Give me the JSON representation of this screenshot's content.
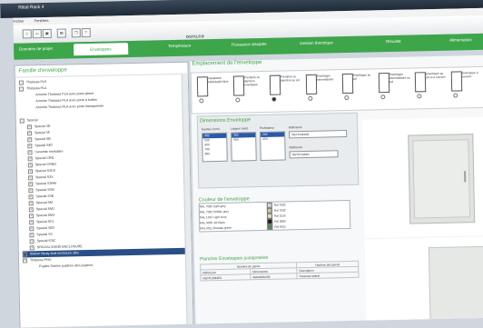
{
  "window": {
    "title": "Rittal Rack 4"
  },
  "menu": [
    "Fichier",
    "Fenêtres"
  ],
  "toolbar": {
    "brand": "OUTILCO",
    "buttons": [
      "new-icon",
      "open-icon",
      "save-icon",
      "print-icon",
      "copy-icon",
      "help-icon"
    ]
  },
  "tabs": [
    {
      "label": "Données de projet"
    },
    {
      "label": "Enveloppes",
      "active": true
    },
    {
      "label": "Température"
    },
    {
      "label": "Puissance dissipée"
    },
    {
      "label": "Gestion thermique"
    },
    {
      "label": "Résultat"
    },
    {
      "label": "Alimentation"
    }
  ],
  "left": {
    "title": "Famille d'enveloppe",
    "items": [
      {
        "label": "Thalassa PLS",
        "level": 0,
        "exp": "-"
      },
      {
        "label": "Thalassa PLA",
        "level": 0,
        "exp": "-"
      },
      {
        "label": "Armoire Thalassa PLA avec porte pleine",
        "level": 2
      },
      {
        "label": "Armoire Thalassa PLA avec porte à hublot",
        "level": 2
      },
      {
        "label": "Armoire Thalassa PLA avec porte transparente",
        "level": 2
      },
      {
        "label": "",
        "level": 0
      },
      {
        "label": "Spacial",
        "level": 0,
        "exp": "-"
      },
      {
        "label": "Spacial 3D",
        "level": 1,
        "exp": "+"
      },
      {
        "label": "Spacial 3F",
        "level": 1,
        "exp": "+"
      },
      {
        "label": "Spacial SB",
        "level": 1,
        "exp": "+"
      },
      {
        "label": "Spacial SBT",
        "level": 1,
        "exp": "+"
      },
      {
        "label": "Cassette modulaire",
        "level": 1,
        "exp": "+"
      },
      {
        "label": "Spacial CRN",
        "level": 1,
        "exp": "+"
      },
      {
        "label": "Spacial CRNG",
        "level": 1,
        "exp": "+"
      },
      {
        "label": "Spacial S3DX",
        "level": 1,
        "exp": "+"
      },
      {
        "label": "Spacial S3X",
        "level": 1,
        "exp": "+"
      },
      {
        "label": "Spacial S3HM",
        "level": 1,
        "exp": "+"
      },
      {
        "label": "Spacial S3M",
        "level": 1,
        "exp": "+"
      },
      {
        "label": "Spacial S3E",
        "level": 1,
        "exp": "+"
      },
      {
        "label": "Spacial SM",
        "level": 1,
        "exp": "+"
      },
      {
        "label": "Spacial SM1",
        "level": 1,
        "exp": "+"
      },
      {
        "label": "Spacial SM3",
        "level": 1,
        "exp": "+"
      },
      {
        "label": "Spacial SF1",
        "level": 1,
        "exp": "+"
      },
      {
        "label": "Spacial SE3",
        "level": 1,
        "exp": "+"
      },
      {
        "label": "Spacial S3",
        "level": 1,
        "exp": "+"
      },
      {
        "label": "Spacial S3IC",
        "level": 1,
        "exp": "+"
      },
      {
        "label": "SPACIAL EXEDI ENCLOSURE",
        "level": 1,
        "exp": "+"
      },
      {
        "label": "Station Neuty dual enclosure ultra",
        "level": 0,
        "exp": "-",
        "selected": true
      },
      {
        "label": "Thalassa PHO",
        "level": 0,
        "exp": "+"
      },
      {
        "label": "Pupitre Station pupitres ultra pupitres",
        "level": 2
      }
    ]
  },
  "right": {
    "pos_title": "Emplacement de l'enveloppe",
    "positions": [
      {
        "label": "Installation individuelle libre",
        "selected": false
      },
      {
        "label": "Première ou dernière enveloppe",
        "selected": false
      },
      {
        "label": "Première ou dernière au sol",
        "selected": true
      },
      {
        "label": "Enveloppe intermédiaire",
        "selected": false
      },
      {
        "label": "Enveloppe au sol",
        "selected": false
      },
      {
        "label": "Enveloppe intermédiaire au sol",
        "selected": false
      },
      {
        "label": "Enveloppe au sol et à couvert",
        "selected": false
      },
      {
        "label": "Enveloppe à couvert",
        "selected": false
      }
    ],
    "dims_title": "Dimensions Enveloppe",
    "dims": {
      "h_label": "Hauteur (mm)",
      "w_label": "Largeur (mm)",
      "ref_label": "Référence",
      "prof_label": "Profondeur",
      "heights": [
        "400",
        "500",
        "600",
        "700",
        "800"
      ],
      "widths": [
        "300",
        "400"
      ],
      "depths": [
        "200",
        "250"
      ],
      "ref_value": "NSYPLM43G",
      "ref2_label": "Référence",
      "ref2_value": "NSYPLM43G"
    },
    "col_title": "Couleur de l'enveloppe",
    "colors": [
      {
        "label": "RAL 7035 Light grey",
        "code": "Ral 7035",
        "hex": "#d8d9d4"
      },
      {
        "label": "RAL 7032 Pebble grey",
        "code": "Ral 7032",
        "hex": "#c4c1ae"
      },
      {
        "label": "RAL 1015 Light ivory",
        "code": "Ral 1015",
        "hex": "#e5dcc0"
      },
      {
        "label": "RAL 9005 Jet black",
        "code": "Ral 9005",
        "hex": "#1e1e1e"
      },
      {
        "label": "RAL 6011 Reseda green",
        "code": "Ral 6011",
        "hex": "#5a8656"
      }
    ],
    "acc_title": "Plancher Enveloppes juxtaposées",
    "acc": {
      "headers": [
        "Nombre de parois",
        "Hauteur des parois"
      ],
      "sub": [
        "Référence",
        "Dimensions",
        "Description"
      ],
      "row": [
        "NSYPLM43EA",
        "400x300x200",
        "Panneau latéral"
      ]
    }
  }
}
